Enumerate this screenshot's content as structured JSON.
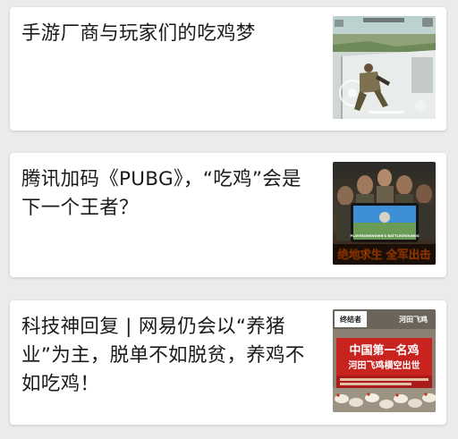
{
  "feed": {
    "items": [
      {
        "title": "手游厂商与玩家们的吃鸡梦",
        "thumbnail": {
          "scene": "game-soldier-rooftop"
        }
      },
      {
        "title": "腾讯加码《PUBG》，“吃鸡”会是下一个王者？",
        "thumbnail": {
          "scene": "pubg-poster",
          "caption": "绝地求生 全军出击",
          "screen_text": "PLAYERUNKNOWN'S BATTLEGROUNDS"
        }
      },
      {
        "title": "科技神回复 | 网易仍会以“养猪业”为主，脱单不如脱贫，养鸡不如吃鸡！",
        "thumbnail": {
          "scene": "news-banner-chickens",
          "headline": "中国第一名鸡",
          "subheadline": "河田飞鸡横空出世",
          "top_left_text": "终结者",
          "top_right_text": "河田飞鸡"
        }
      }
    ]
  },
  "colors": {
    "background": "#ebebeb",
    "card": "#ffffff",
    "title_text": "#1a1a1a",
    "poster_yellow": "#f5c518",
    "banner_red": "#c8231f"
  }
}
